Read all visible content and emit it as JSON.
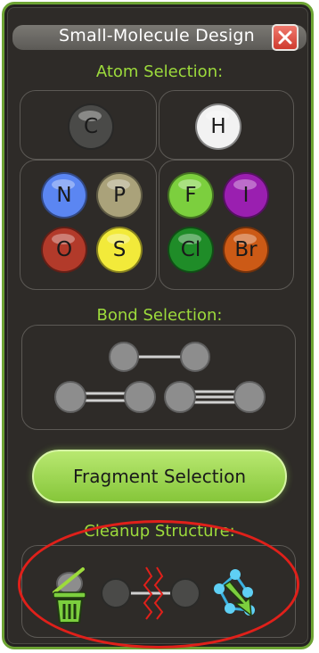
{
  "window": {
    "title": "Small-Molecule Design"
  },
  "sections": {
    "atoms": "Atom Selection:",
    "bonds": "Bond Selection:",
    "cleanup": "Cleanup Structure:"
  },
  "atoms": {
    "carbon": {
      "symbol": "C",
      "color": "#4a4a48"
    },
    "hydrogen": {
      "symbol": "H",
      "color": "#f2f2f2"
    },
    "nitrogen": {
      "symbol": "N",
      "color": "#5b86f2"
    },
    "phosphorus": {
      "symbol": "P",
      "color": "#aaa27a"
    },
    "fluorine": {
      "symbol": "F",
      "color": "#7ccf3e"
    },
    "iodine": {
      "symbol": "I",
      "color": "#9a1fb0"
    },
    "oxygen": {
      "symbol": "O",
      "color": "#b23a2a"
    },
    "sulfur": {
      "symbol": "S",
      "color": "#f2ea3a"
    },
    "chlorine": {
      "symbol": "Cl",
      "color": "#1f8c28"
    },
    "bromine": {
      "symbol": "Br",
      "color": "#cc5a16"
    }
  },
  "buttons": {
    "fragment": "Fragment Selection"
  },
  "colors": {
    "accent": "#9ddb3c",
    "panel": "#2e2b28",
    "annotation": "#e0201a"
  },
  "icons": {
    "close": "close-icon",
    "single_bond": "single-bond-icon",
    "double_bond": "double-bond-icon",
    "triple_bond": "triple-bond-icon",
    "delete_hydrogens": "delete-hydrogens-icon",
    "break_bond": "break-bond-icon",
    "clean_geometry": "clean-geometry-icon"
  }
}
